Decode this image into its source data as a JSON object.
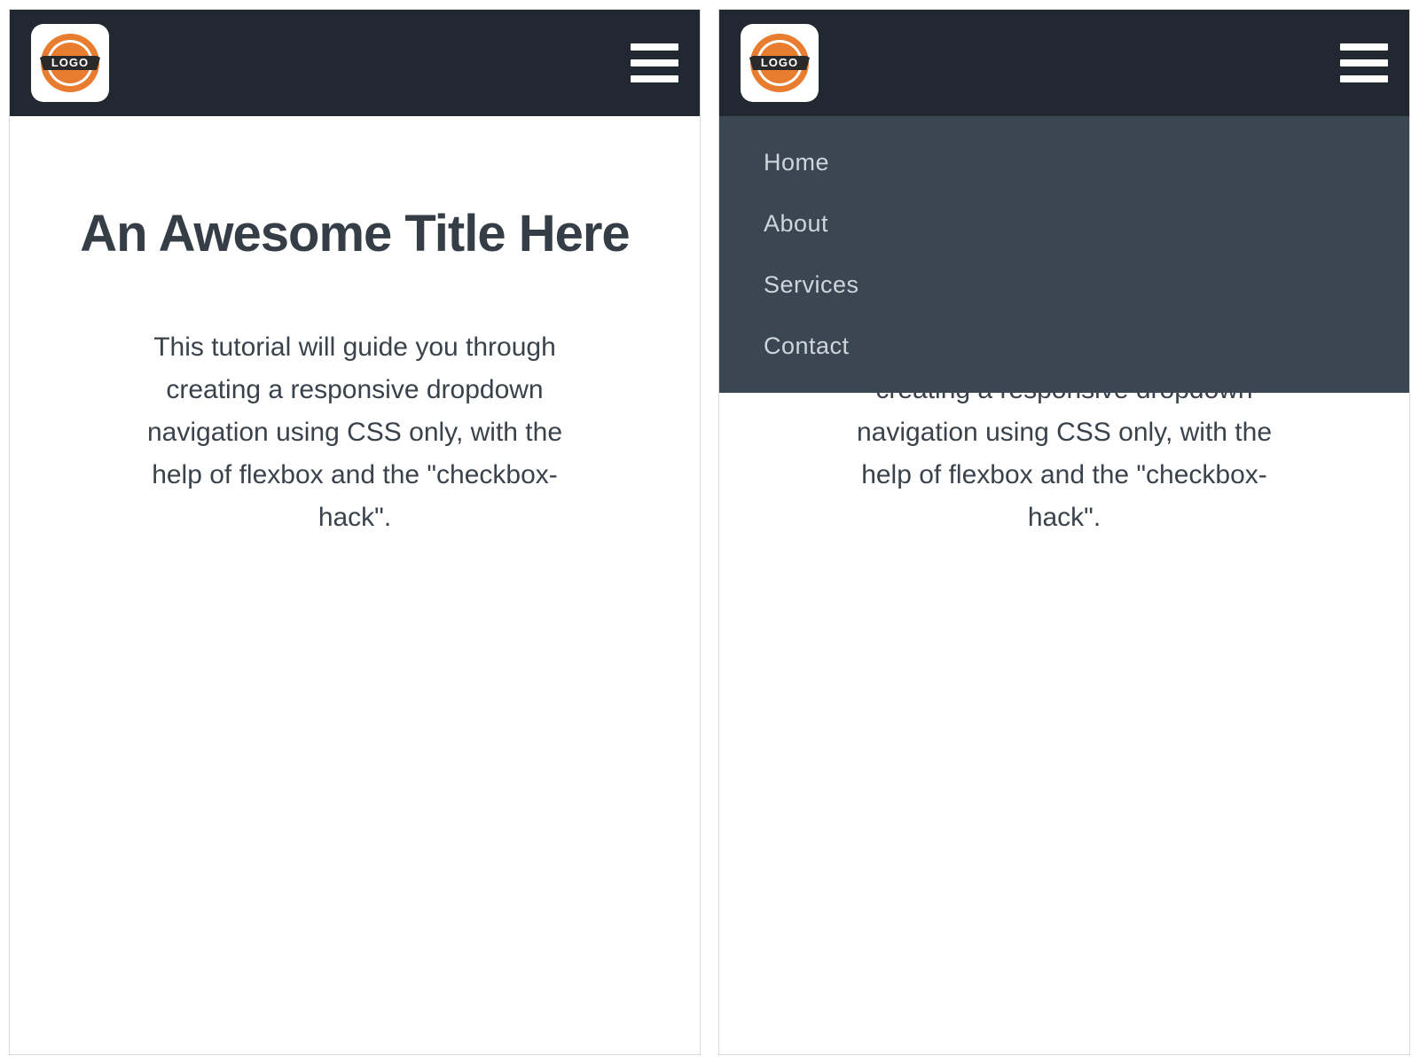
{
  "logo": {
    "text": "LOGO"
  },
  "nav": {
    "items": [
      {
        "label": "Home"
      },
      {
        "label": "About"
      },
      {
        "label": "Services"
      },
      {
        "label": "Contact"
      }
    ]
  },
  "content": {
    "title": "An Awesome Title Here",
    "subtitle": "This tutorial will guide you through creating a responsive dropdown navigation using CSS only, with the help of flexbox and the \"checkbox-hack\"."
  }
}
